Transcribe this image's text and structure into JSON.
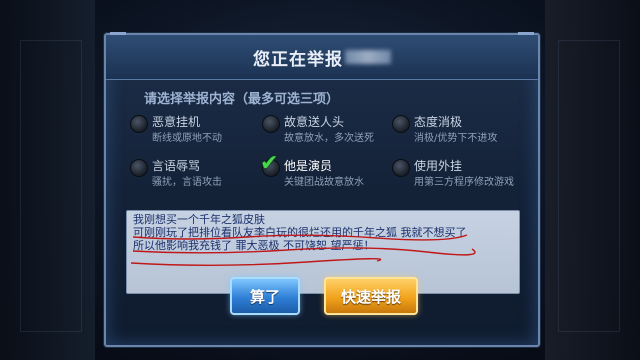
{
  "dialog": {
    "title": "您正在举报"
  },
  "section": {
    "title": "请选择举报内容（最多可选三项）"
  },
  "options": [
    {
      "title": "恶意挂机",
      "desc": "断线或原地不动",
      "selected": false
    },
    {
      "title": "故意送人头",
      "desc": "故意放水，多次送死",
      "selected": false
    },
    {
      "title": "态度消极",
      "desc": "消极/优势下不进攻",
      "selected": false
    },
    {
      "title": "言语辱骂",
      "desc": "骚扰，言语攻击",
      "selected": false
    },
    {
      "title": "他是演员",
      "desc": "关键团战故意放水",
      "selected": true
    },
    {
      "title": "使用外挂",
      "desc": "用第三方程序修改游戏",
      "selected": false
    }
  ],
  "report": {
    "text": "我刚想买一个千年之狐皮肤\n可刚刚玩了把排位看队友李白玩的很烂还用的千年之狐 我就不想买了\n所以他影响我充钱了 罪大恶极 不可饶恕 望严惩！"
  },
  "buttons": {
    "cancel": "算了",
    "submit": "快速举报"
  },
  "colors": {
    "accent_blue": "#2f7fd6",
    "accent_orange": "#f2a31c",
    "check_green": "#45d84a"
  }
}
